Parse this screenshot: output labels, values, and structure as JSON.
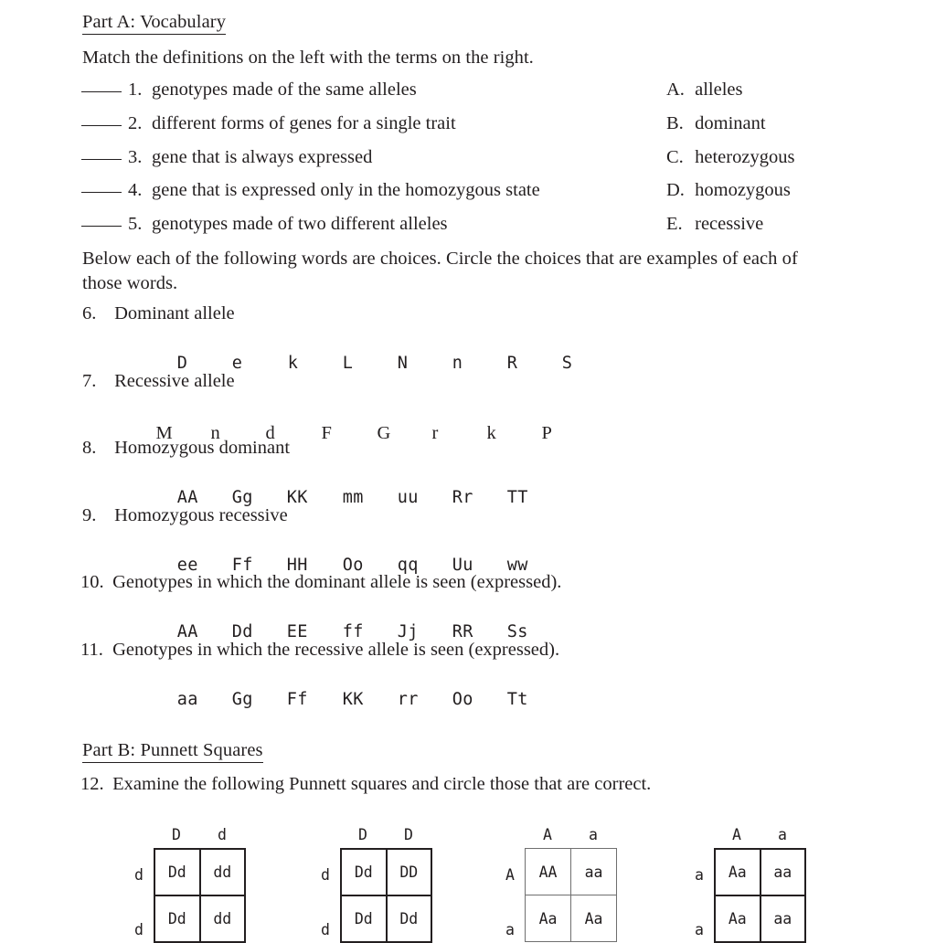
{
  "document": {
    "background_color": "#ffffff",
    "text_color": "#231f20"
  },
  "part_a": {
    "heading": "Part A:  Vocabulary",
    "instruction": "Match the definitions on the left with the terms on the right.",
    "definitions": [
      {
        "number": "1.",
        "text": "genotypes made of the same alleles"
      },
      {
        "number": "2.",
        "text": "different forms of genes for a single trait"
      },
      {
        "number": "3.",
        "text": "gene that is always expressed"
      },
      {
        "number": "4.",
        "text": "gene that is expressed only in the homozygous state"
      },
      {
        "number": "5.",
        "text": "genotypes made of two different alleles"
      }
    ],
    "terms": [
      {
        "letter": "A.",
        "text": "alleles"
      },
      {
        "letter": "B.",
        "text": "dominant"
      },
      {
        "letter": "C.",
        "text": "heterozygous"
      },
      {
        "letter": "D.",
        "text": "homozygous"
      },
      {
        "letter": "E.",
        "text": "recessive"
      }
    ],
    "circle_instruction": "Below each of the following words are choices.  Circle the choices that are examples of each of those words.",
    "questions": [
      {
        "number": "6.",
        "prompt": "Dominant allele",
        "font": "mono",
        "choices": [
          "D",
          "e",
          "k",
          "L",
          "N",
          "n",
          "R",
          "S"
        ]
      },
      {
        "number": "7.",
        "prompt": "Recessive allele",
        "font": "serif",
        "choices": [
          "M",
          "n",
          "d",
          "F",
          "G",
          "r",
          "k",
          "P"
        ]
      },
      {
        "number": "8.",
        "prompt": "Homozygous dominant",
        "font": "mono",
        "choices": [
          "AA",
          "Gg",
          "KK",
          "mm",
          "uu",
          "Rr",
          "TT"
        ]
      },
      {
        "number": "9.",
        "prompt": "Homozygous recessive",
        "font": "mono",
        "choices": [
          "ee",
          "Ff",
          "HH",
          "Oo",
          "qq",
          "Uu",
          "ww"
        ]
      },
      {
        "number": "10.",
        "prompt": "Genotypes in which the dominant allele is seen (expressed).",
        "font": "mono",
        "choices": [
          "AA",
          "Dd",
          "EE",
          "ff",
          "Jj",
          "RR",
          "Ss"
        ]
      },
      {
        "number": "11.",
        "prompt": "Genotypes in which the recessive allele is seen (expressed).",
        "font": "mono",
        "choices": [
          "aa",
          "Gg",
          "Ff",
          "KK",
          "rr",
          "Oo",
          "Tt"
        ]
      }
    ]
  },
  "part_b": {
    "heading": "Part B:  Punnett Squares",
    "question": {
      "number": "12.",
      "prompt": "Examine the following Punnett squares and circle those that are correct."
    },
    "squares": [
      {
        "id": "punnett-square-1",
        "col_headers": [
          "D",
          "d"
        ],
        "row_headers": [
          "d",
          "d"
        ],
        "cells": [
          [
            "Dd",
            "dd"
          ],
          [
            "Dd",
            "dd"
          ]
        ]
      },
      {
        "id": "punnett-square-2",
        "col_headers": [
          "D",
          "D"
        ],
        "row_headers": [
          "d",
          "d"
        ],
        "cells": [
          [
            "Dd",
            "DD"
          ],
          [
            "Dd",
            "Dd"
          ]
        ]
      },
      {
        "id": "punnett-square-3",
        "col_headers": [
          "A",
          "a"
        ],
        "row_headers": [
          "A",
          "a"
        ],
        "cells": [
          [
            "AA",
            "aa"
          ],
          [
            "Aa",
            "Aa"
          ]
        ]
      },
      {
        "id": "punnett-square-4",
        "col_headers": [
          "A",
          "a"
        ],
        "row_headers": [
          "a",
          "a"
        ],
        "cells": [
          [
            "Aa",
            "aa"
          ],
          [
            "Aa",
            "aa"
          ]
        ]
      }
    ]
  }
}
